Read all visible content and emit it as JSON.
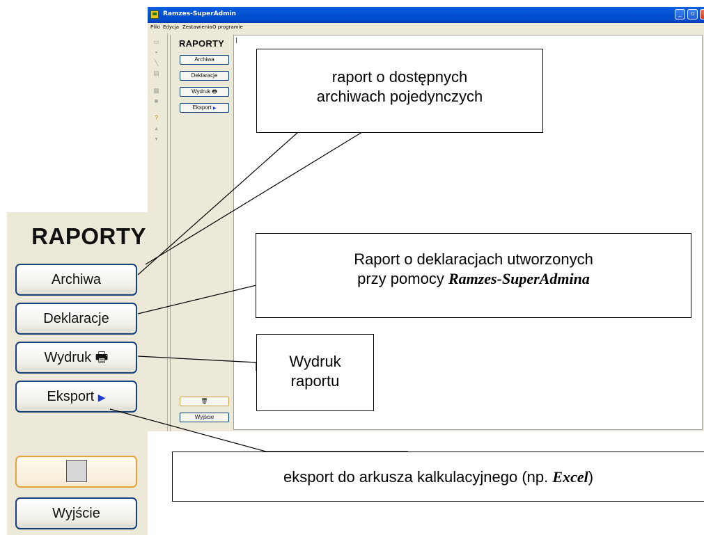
{
  "window": {
    "title": "Ramzes-SuperAdmin",
    "controls": {
      "minimize": "_",
      "maximize": "▫",
      "close": "x"
    }
  },
  "menu": [
    "Pliki",
    "Edycja",
    "Zestawienia",
    "O programie"
  ],
  "sidebar": {
    "title": "RAPORTY",
    "buttons": {
      "archiwa": "Archiwa",
      "deklaracje": "Deklaracje",
      "wydruk": "Wydruk",
      "eksport": "Eksport",
      "wyjscie": "Wyjście"
    }
  },
  "zoom": {
    "title": "RAPORTY",
    "buttons": {
      "archiwa": "Archiwa",
      "deklaracje": "Deklaracje",
      "wydruk": "Wydruk",
      "eksport": "Eksport",
      "wyjscie": "Wyjście"
    }
  },
  "callouts": {
    "archiwa": {
      "line1": "raport o dostępnych",
      "line2": "archiwach pojedynczych"
    },
    "deklaracje": {
      "line1": "Raport o deklaracjach utworzonych",
      "line2_pre": "przy pomocy ",
      "line2_emph": "Ramzes-SuperAdmina"
    },
    "wydruk": {
      "line1": "Wydruk",
      "line2": "raportu"
    },
    "eksport": {
      "pre": "eksport do arkusza kalkulacyjnego (np. ",
      "emph": "Excel",
      "post": ")"
    }
  },
  "icons": {
    "printer": "printer-icon",
    "arrow": "triangle-right-icon",
    "trash": "trash-icon",
    "help": "question-icon"
  }
}
